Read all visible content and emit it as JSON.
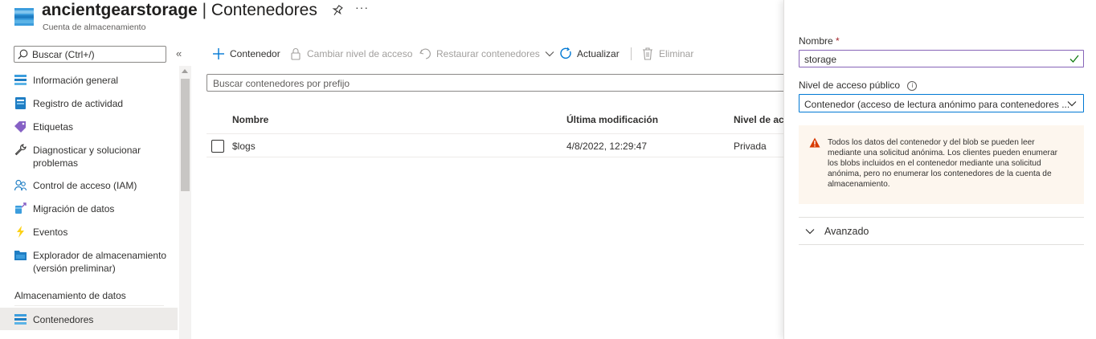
{
  "header": {
    "resource_name": "ancientgearstorage",
    "separator": "|",
    "page_name": "Contenedores",
    "subtitle": "Cuenta de almacenamiento",
    "more_label": "···"
  },
  "sidebar": {
    "search_placeholder": "Buscar (Ctrl+/)",
    "collapse_label": "«",
    "items": [
      {
        "label": "Información general",
        "icon": "overview-icon"
      },
      {
        "label": "Registro de actividad",
        "icon": "activity-log-icon"
      },
      {
        "label": "Etiquetas",
        "icon": "tag-icon"
      },
      {
        "label": "Diagnosticar y solucionar problemas",
        "icon": "wrench-icon"
      },
      {
        "label": "Control de acceso (IAM)",
        "icon": "people-icon"
      },
      {
        "label": "Migración de datos",
        "icon": "data-migration-icon"
      },
      {
        "label": "Eventos",
        "icon": "lightning-icon"
      },
      {
        "label": "Explorador de almacenamiento (versión preliminar)",
        "icon": "storage-explorer-icon"
      }
    ],
    "section_title": "Almacenamiento de datos",
    "selected_item": {
      "label": "Contenedores",
      "icon": "containers-icon"
    }
  },
  "toolbar": {
    "add_container": "Contenedor",
    "change_access": "Cambiar nivel de acceso",
    "restore": "Restaurar contenedores",
    "refresh": "Actualizar",
    "delete": "Eliminar"
  },
  "filter": {
    "placeholder": "Buscar contenedores por prefijo"
  },
  "table": {
    "columns": [
      "Nombre",
      "Última modificación",
      "Nivel de acc"
    ],
    "rows": [
      {
        "name": "$logs",
        "modified": "4/8/2022, 12:29:47",
        "access": "Privada"
      }
    ]
  },
  "panel": {
    "name_label": "Nombre",
    "required_mark": "*",
    "name_value": "storage",
    "access_label": "Nivel de acceso público",
    "access_value": "Contenedor (acceso de lectura anónimo para contenedores ...",
    "warning_text": "Todos los datos del contenedor y del blob se pueden leer mediante una solicitud anónima. Los clientes pueden enumerar los blobs incluidos en el contenedor mediante una solicitud anónima, pero no enumerar los contenedores de la cuenta de almacenamiento.",
    "advanced_label": "Avanzado"
  },
  "colors": {
    "accent": "#0078d4",
    "valid_border": "#8764b8",
    "warning_bg": "#fdf6ee",
    "warning_icon": "#d83b01",
    "check": "#107c10"
  }
}
